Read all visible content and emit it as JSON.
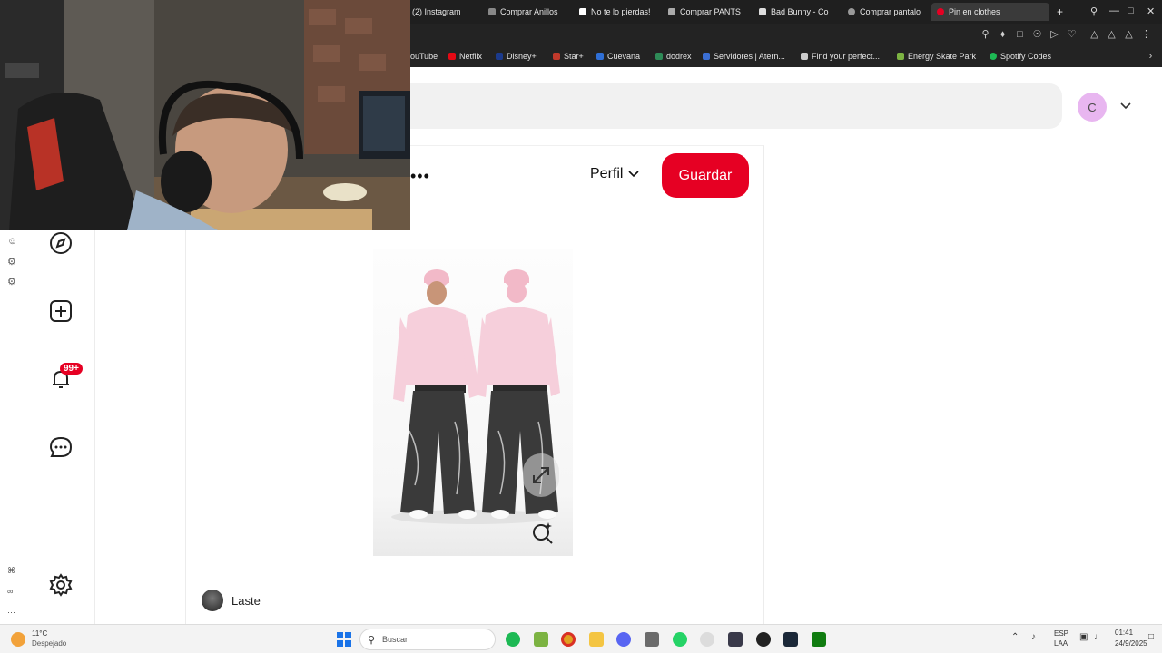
{
  "browser": {
    "tabs": [
      {
        "label": "(2) Instagram"
      },
      {
        "label": "Comprar Anillos"
      },
      {
        "label": "No te lo pierdas!"
      },
      {
        "label": "Comprar PANTS"
      },
      {
        "label": "Bad Bunny - Co"
      },
      {
        "label": "Comprar pantalo"
      },
      {
        "label": "Pin en clothes"
      }
    ],
    "new_tab": "+",
    "bookmarks": [
      {
        "label": "ouTube"
      },
      {
        "label": "Netflix"
      },
      {
        "label": "Disney+"
      },
      {
        "label": "Star+"
      },
      {
        "label": "Cuevana"
      },
      {
        "label": "dodrex"
      },
      {
        "label": "Servidores | Atern..."
      },
      {
        "label": "Find your perfect..."
      },
      {
        "label": "Energy Skate Park"
      },
      {
        "label": "Spotify Codes"
      }
    ]
  },
  "header": {
    "avatar_letter": "C"
  },
  "nav": {
    "notification_badge": "99+"
  },
  "pin": {
    "more": "•••",
    "profile_select": "Perfil",
    "save_label": "Guardar",
    "author_name": "Laste"
  },
  "taskbar": {
    "weather_temp": "11°C",
    "weather_desc": "Despejado",
    "search_placeholder": "Buscar",
    "lang_top": "ESP",
    "lang_bottom": "LAA",
    "time": "01:41",
    "date": "24/9/2025"
  },
  "colors": {
    "accent": "#e60023",
    "avatar_bg": "#e8b6f0",
    "chrome_dark": "#1f1f1f"
  }
}
